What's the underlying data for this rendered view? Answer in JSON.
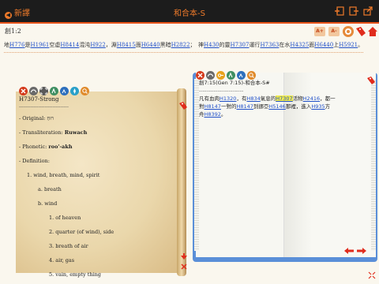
{
  "topbar": {
    "back_label": "新譯",
    "title": "和合本-S"
  },
  "verse_header": {
    "ref": "創1:2",
    "font_up": "A+",
    "font_down": "A-"
  },
  "verse": {
    "parts": [
      {
        "t": "地"
      },
      {
        "a": "H776"
      },
      {
        "t": "是"
      },
      {
        "a": "H1961"
      },
      {
        "t": "空虛"
      },
      {
        "a": "H8414"
      },
      {
        "t": "混沌"
      },
      {
        "a": "H922"
      },
      {
        "t": "，淵"
      },
      {
        "a": "H8415"
      },
      {
        "t": "面"
      },
      {
        "a": "H6440"
      },
      {
        "t": "黑暗"
      },
      {
        "a": "H2822"
      },
      {
        "t": "；　神"
      },
      {
        "a": "H430"
      },
      {
        "t": "的靈"
      },
      {
        "a": "H7307"
      },
      {
        "t": "運行"
      },
      {
        "a": "H7363"
      },
      {
        "t": "在水"
      },
      {
        "a": "H4325"
      },
      {
        "t": "面"
      },
      {
        "a": "H6440"
      },
      {
        "t": "上"
      },
      {
        "a": "H5921"
      },
      {
        "t": "。"
      }
    ]
  },
  "strong_popup": {
    "header": "H7307-Strong",
    "lines": [
      {
        "text": "- Original: רוּחַ"
      },
      {
        "text": "- Transliteration: ",
        "bold": "Ruwach"
      },
      {
        "text": "- Phonetic: ",
        "bold": "roo'-akh"
      },
      {
        "text": "- Definition:"
      },
      {
        "text": "1. wind, breath, mind, spirit"
      },
      {
        "text": "a. breath"
      },
      {
        "text": "b. wind"
      },
      {
        "text": "1. of heaven"
      },
      {
        "text": "2. quarter (of wind), side"
      },
      {
        "text": "3. breath of air"
      },
      {
        "text": "4. air, gas"
      },
      {
        "text": "5. vain, empty thing"
      }
    ]
  },
  "cross_popup": {
    "header": "創7:15(Gen 7:15)-和合本-S#",
    "divider": "------------------------",
    "l1a": "凡有血肉",
    "l1b": "H1320",
    "l1c": "，有",
    "l1d": "H834",
    "l1e": "氣息的",
    "l1f": "H7307",
    "l1g": "活物",
    "l1h": "H2416",
    "l1i": "，都一",
    "l2a": "對",
    "l2b": "H8147",
    "l2c": "一對的",
    "l2d": "H8147",
    "l2e": "到挪亞",
    "l2f": "H5146",
    "l2g": "那裡，進入",
    "l2h": "H935",
    "l2i": "方",
    "l3a": "舟",
    "l3b": "H8392",
    "l3c": "。"
  },
  "icons": {
    "accent": "#e8541a",
    "topbar": [
      "bookmark-add-icon",
      "bookmark-remove-icon",
      "share-icon"
    ],
    "header": [
      "font-up-icon",
      "font-down-icon",
      "highlighter-icon",
      "tag-icon",
      "home-icon"
    ]
  }
}
